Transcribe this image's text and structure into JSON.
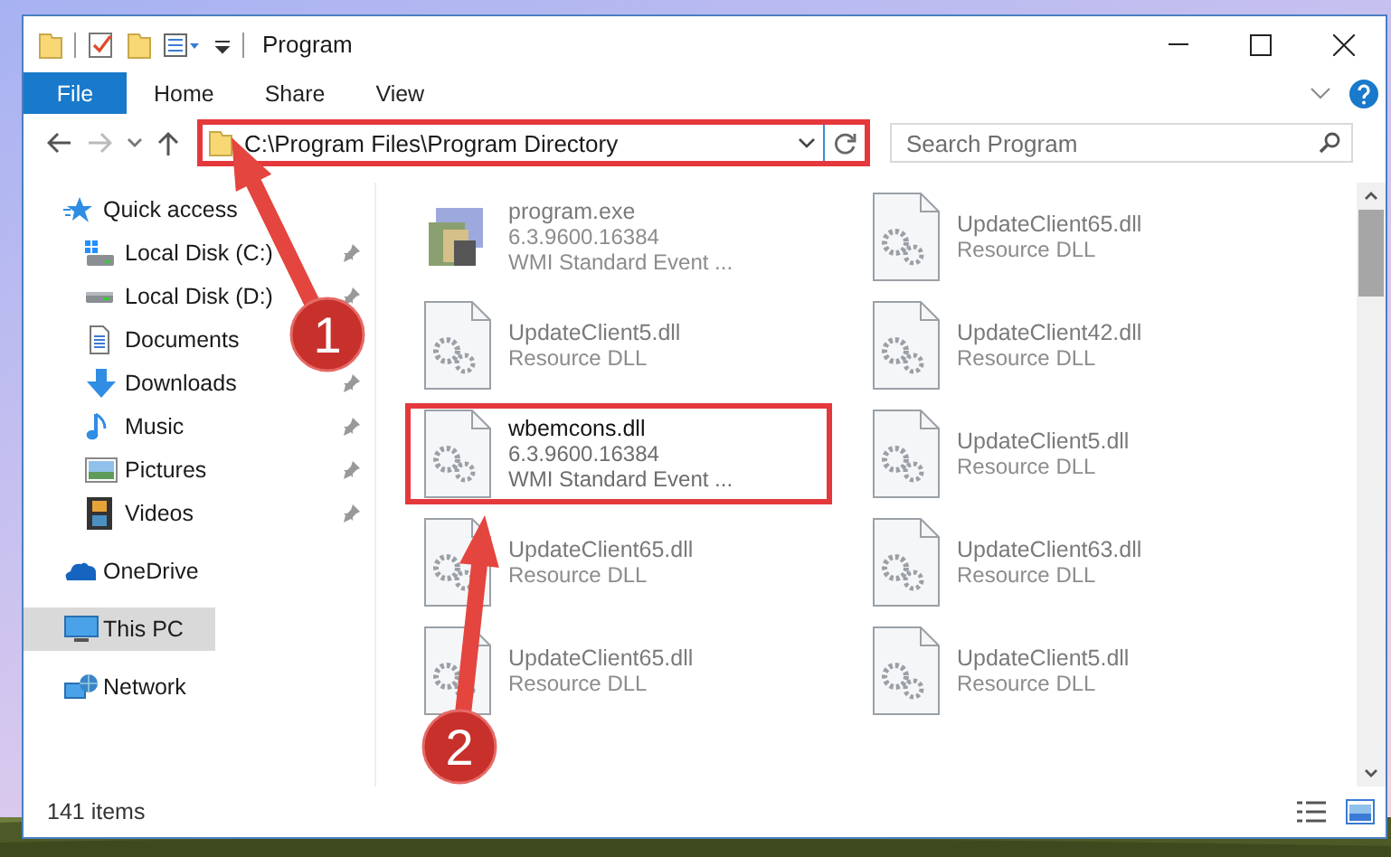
{
  "window": {
    "title": "Program"
  },
  "ribbon_tabs": [
    {
      "label": "File",
      "kind": "file"
    },
    {
      "label": "Home",
      "kind": "tab"
    },
    {
      "label": "Share",
      "kind": "tab"
    },
    {
      "label": "View",
      "kind": "tab"
    }
  ],
  "address": {
    "path": "C:\\Program Files\\Program Directory",
    "highlighted": true
  },
  "search": {
    "placeholder": "Search Program"
  },
  "sidebar": {
    "items": [
      {
        "label": "Quick access",
        "kind": "star",
        "selected": false,
        "children": [
          {
            "label": "Local Disk (C:)",
            "kind": "windrive",
            "pinned": true,
            "selected": false
          },
          {
            "label": "Local Disk (D:)",
            "kind": "drive",
            "pinned": true,
            "selected": false
          },
          {
            "label": "Documents",
            "kind": "document",
            "selected": false
          },
          {
            "label": "Downloads",
            "kind": "download",
            "pinned": true,
            "selected": false
          },
          {
            "label": "Music",
            "kind": "music",
            "pinned": true,
            "selected": false
          },
          {
            "label": "Pictures",
            "kind": "picture",
            "pinned": true,
            "selected": false
          },
          {
            "label": "Videos",
            "kind": "video",
            "pinned": true,
            "selected": false
          }
        ]
      },
      {
        "label": "OneDrive",
        "kind": "cloud",
        "selected": false
      },
      {
        "label": "This PC",
        "kind": "computer",
        "selected": true
      },
      {
        "label": "Network",
        "kind": "network",
        "selected": false
      }
    ]
  },
  "files": [
    {
      "name": "program.exe",
      "details": [
        "6.3.9600.16384",
        "WMI Standard Event ..."
      ],
      "kind": "exe",
      "dimmed": true,
      "highlighted": false
    },
    {
      "name": "UpdateClient65.dll",
      "details": [
        "Resource DLL"
      ],
      "kind": "dll",
      "dimmed": true,
      "highlighted": false
    },
    {
      "name": "UpdateClient5.dll",
      "details": [
        "Resource DLL"
      ],
      "kind": "dll",
      "dimmed": true,
      "highlighted": false
    },
    {
      "name": "UpdateClient42.dll",
      "details": [
        "Resource DLL"
      ],
      "kind": "dll",
      "dimmed": true,
      "highlighted": false
    },
    {
      "name": "wbemcons.dll",
      "details": [
        "6.3.9600.16384",
        "WMI Standard Event ..."
      ],
      "kind": "dll",
      "dimmed": false,
      "highlighted": true
    },
    {
      "name": "UpdateClient5.dll",
      "details": [
        "Resource DLL"
      ],
      "kind": "dll",
      "dimmed": true,
      "highlighted": false
    },
    {
      "name": "UpdateClient65.dll",
      "details": [
        "Resource DLL"
      ],
      "kind": "dll",
      "dimmed": true,
      "highlighted": false
    },
    {
      "name": "UpdateClient63.dll",
      "details": [
        "Resource DLL"
      ],
      "kind": "dll",
      "dimmed": true,
      "highlighted": false
    },
    {
      "name": "UpdateClient65.dll",
      "details": [
        "Resource DLL"
      ],
      "kind": "dll",
      "dimmed": true,
      "highlighted": false
    },
    {
      "name": "UpdateClient5.dll",
      "details": [
        "Resource DLL"
      ],
      "kind": "dll",
      "dimmed": true,
      "highlighted": false
    }
  ],
  "status_bar": {
    "item_count": "141 items"
  },
  "annotations": [
    {
      "label": "1"
    },
    {
      "label": "2"
    }
  ]
}
